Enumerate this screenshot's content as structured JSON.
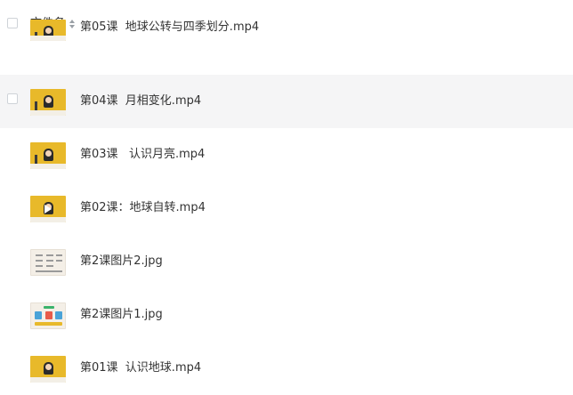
{
  "header": {
    "column_label": "文件名"
  },
  "files": [
    {
      "name": "第05课  地球公转与四季划分.mp4",
      "kind": "video",
      "thumb": "video-thumbnail"
    },
    {
      "name": "第04课  月相变化.mp4",
      "kind": "video",
      "thumb": "video-thumbnail"
    },
    {
      "name": "第03课   认识月亮.mp4",
      "kind": "video",
      "thumb": "video-thumbnail"
    },
    {
      "name": "第02课：地球自转.mp4",
      "kind": "video",
      "thumb": "video-thumbnail-play"
    },
    {
      "name": "第2课图片2.jpg",
      "kind": "image",
      "thumb": "image-thumbnail"
    },
    {
      "name": "第2课图片1.jpg",
      "kind": "image",
      "thumb": "image-thumbnail"
    },
    {
      "name": "第01课  认识地球.mp4",
      "kind": "video",
      "thumb": "video-thumbnail"
    }
  ],
  "colors": {
    "hover_row": "#f5f5f6",
    "thumb_yellow": "#e8b92a"
  }
}
